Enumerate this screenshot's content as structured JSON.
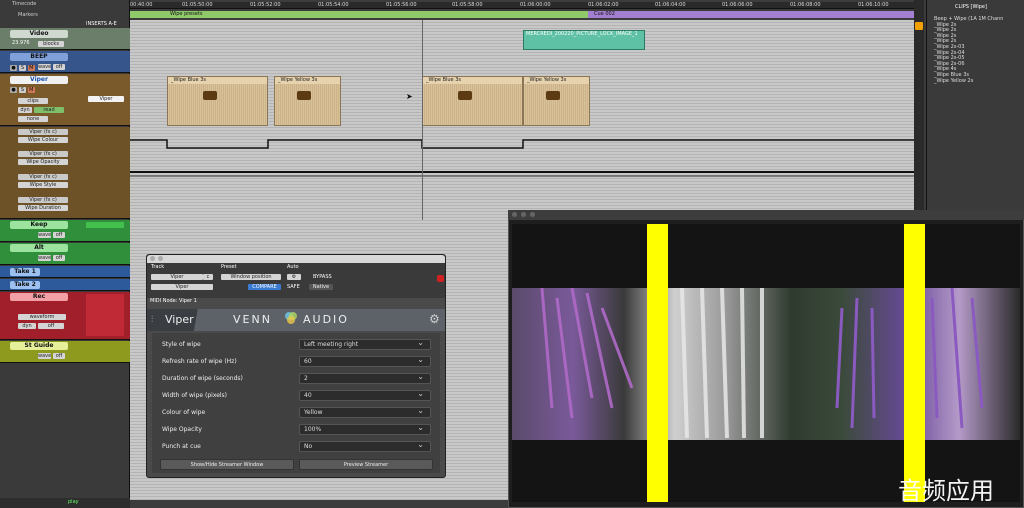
{
  "header": {
    "timecode_label": "Timecode",
    "markers_label": "Markers",
    "inserts_label": "INSERTS A-E"
  },
  "ruler": {
    "ticks": [
      "00:40:00",
      "01:05:50:00",
      "01:05:52:00",
      "01:05:54:00",
      "01:05:56:00",
      "01:05:58:00",
      "01:06:00:00",
      "01:06:02:00",
      "01:06:04:00",
      "01:06:06:00",
      "01:06:08:00",
      "01:06:10:00"
    ]
  },
  "markers": {
    "wipe_presets": "Wipe presets",
    "cue": "Cue 002"
  },
  "tracks": {
    "video": {
      "name": "Video",
      "fps": "23.976",
      "view": "blocks"
    },
    "beep": {
      "name": "BEEP",
      "view": "wave",
      "auto": "off"
    },
    "viper": {
      "name": "Viper",
      "view": "clips",
      "auto": "read",
      "dyn": "dyn",
      "none": "none",
      "insert": "Viper"
    },
    "lanes": [
      {
        "plugin": "Viper",
        "fx": "(fx c)",
        "param": "Wipe Colour"
      },
      {
        "plugin": "Viper",
        "fx": "(fx c)",
        "param": "Wipe Opacity"
      },
      {
        "plugin": "Viper",
        "fx": "(fx c)",
        "param": "Wipe Style"
      },
      {
        "plugin": "Viper",
        "fx": "(fx c)",
        "param": "Wipe Duration"
      }
    ],
    "keep": {
      "name": "Keep",
      "view": "wave",
      "auto": "off"
    },
    "alt": {
      "name": "Alt",
      "view": "wave",
      "auto": "off"
    },
    "take1": {
      "name": "Take 1"
    },
    "take2": {
      "name": "Take 2",
      "view": "wave",
      "auto": "off"
    },
    "rec": {
      "name": "Rec",
      "view": "waveform",
      "dyn": "dyn",
      "auto": "off"
    },
    "guide": {
      "name": "St Guide",
      "view": "wave",
      "auto": "off"
    }
  },
  "timeline": {
    "video_clip": "MERCREDI_200220_PICTURE_LOCK_IMAGE_1",
    "clips": [
      "_Wipe Blue 3s",
      "_Wipe Yellow 3s",
      "_Wipe Blue 3s",
      "_Wipe Yellow 3s"
    ]
  },
  "bottom": {
    "play": "play"
  },
  "plugin": {
    "track_label": "Track",
    "preset_label": "Preset",
    "auto_label": "Auto",
    "track1": "Viper",
    "track_c": "c",
    "track2": "Viper",
    "preset_name": "Window position",
    "compare": "COMPARE",
    "bypass": "BYPASS",
    "safe": "SAFE",
    "native": "Native",
    "midi_node": "MIDI Node: Viper 1",
    "product": "Viper",
    "brand_venn": "VENN",
    "brand_audio": "AUDIO",
    "params": [
      {
        "k": "Style of wipe",
        "v": "Left meeting right"
      },
      {
        "k": "Refresh rate of wipe (Hz)",
        "v": "60"
      },
      {
        "k": "Duration of wipe (seconds)",
        "v": "2"
      },
      {
        "k": "Width of wipe (pixels)",
        "v": "40"
      },
      {
        "k": "Colour of wipe",
        "v": "Yellow"
      },
      {
        "k": "Wipe Opacity",
        "v": "100%"
      },
      {
        "k": "Punch at cue",
        "v": "No"
      }
    ],
    "btn_streamer": "Show/Hide Streamer Window",
    "btn_preview": "Preview Streamer"
  },
  "clips_panel": {
    "title": "CLIPS [Wipe]",
    "items": [
      "Beep + Wipe (1A 1M Chann",
      "_Wipe 2s",
      "_Wipe 2s",
      "_Wipe 2s",
      "_Wipe 2s",
      "_Wipe 2s-03",
      "_Wipe 2s-04",
      "_Wipe 2s-05",
      "_Wipe 2s-06",
      "_Wipe 4s",
      "_Wipe Blue 3s",
      "_Wipe Yellow 2s"
    ]
  },
  "watermark": "音频应用",
  "colors": {
    "wipe": "#ffff00",
    "green_bar": "#8fc96a",
    "purple_bar": "#a27fd0",
    "video_clip": "#5ec0a4"
  }
}
